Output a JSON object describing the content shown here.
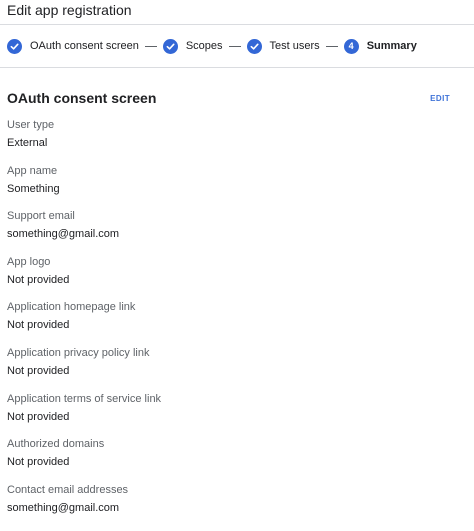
{
  "header": {
    "title": "Edit app registration"
  },
  "stepper": {
    "steps": [
      {
        "label": "OAuth consent screen",
        "state": "done"
      },
      {
        "label": "Scopes",
        "state": "done"
      },
      {
        "label": "Test users",
        "state": "done"
      },
      {
        "label": "Summary",
        "state": "current",
        "number": "4"
      }
    ]
  },
  "section": {
    "title": "OAuth consent screen",
    "edit_label": "EDIT"
  },
  "fields": [
    {
      "label": "User type",
      "value": "External"
    },
    {
      "label": "App name",
      "value": "Something"
    },
    {
      "label": "Support email",
      "value": "something@gmail.com"
    },
    {
      "label": "App logo",
      "value": "Not provided"
    },
    {
      "label": "Application homepage link",
      "value": "Not provided"
    },
    {
      "label": "Application privacy policy link",
      "value": "Not provided"
    },
    {
      "label": "Application terms of service link",
      "value": "Not provided"
    },
    {
      "label": "Authorized domains",
      "value": "Not provided"
    },
    {
      "label": "Contact email addresses",
      "value": "something@gmail.com"
    }
  ],
  "colors": {
    "accent": "#3367d6",
    "link": "#3f73d8",
    "label": "#5f6368",
    "text": "#202124",
    "divider": "#dadce0"
  },
  "icons": {
    "done": "check-icon"
  }
}
